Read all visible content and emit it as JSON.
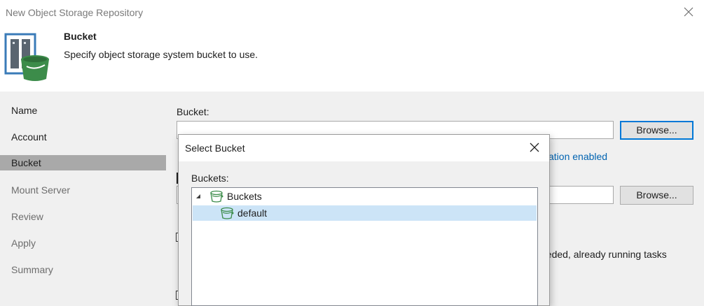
{
  "window": {
    "title": "New Object Storage Repository",
    "close_icon": "close-icon"
  },
  "header": {
    "icon": "object-storage-bucket-icon",
    "title": "Bucket",
    "subtitle": "Specify object storage system bucket to use."
  },
  "nav": {
    "items": [
      {
        "label": "Name",
        "state": "done"
      },
      {
        "label": "Account",
        "state": "done"
      },
      {
        "label": "Bucket",
        "state": "active"
      },
      {
        "label": "Mount Server",
        "state": "future"
      },
      {
        "label": "Review",
        "state": "future"
      },
      {
        "label": "Apply",
        "state": "future"
      },
      {
        "label": "Summary",
        "state": "future"
      }
    ]
  },
  "content": {
    "bucket_label": "Bucket:",
    "bucket_value": "",
    "browse_label": "Browse...",
    "browse2_label": "Browse...",
    "partial_link": "ation enabled",
    "partial_text": "eeded, already running tasks"
  },
  "dialog": {
    "title": "Select Bucket",
    "buckets_label": "Buckets:",
    "tree": [
      {
        "label": "Buckets",
        "expanded": true,
        "icon": "bucket-icon"
      },
      {
        "label": "default",
        "selected": true,
        "icon": "bucket-icon"
      }
    ]
  },
  "colors": {
    "accent": "#0078d7",
    "link": "#0063b1",
    "selection": "#cce4f7",
    "nav_active": "#a9a9a9",
    "bucket_green": "#3c8c4a"
  }
}
